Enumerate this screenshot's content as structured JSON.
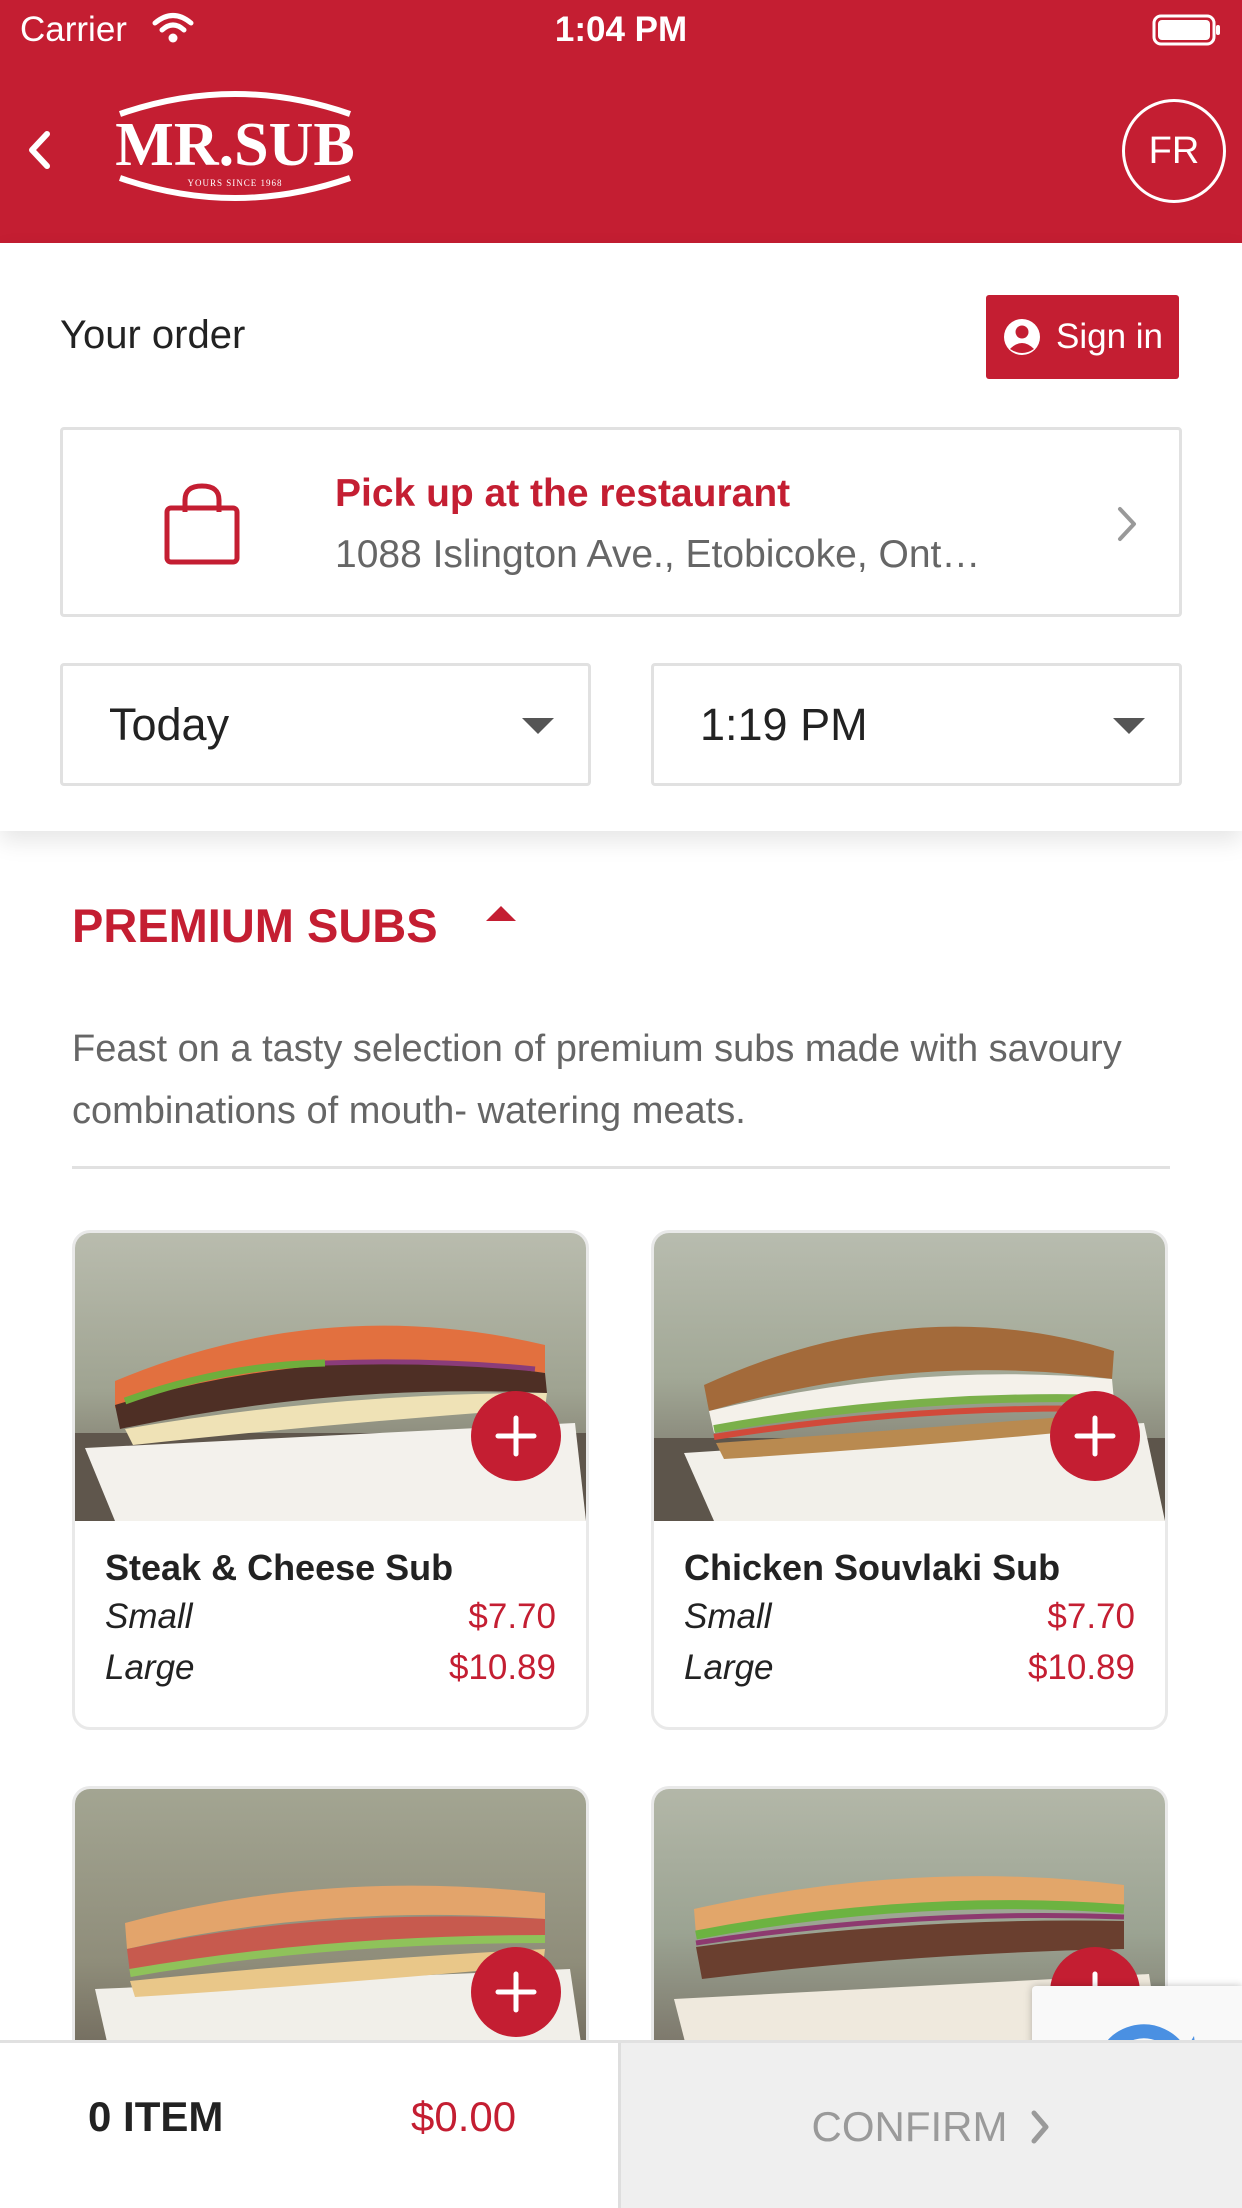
{
  "status_bar": {
    "carrier": "Carrier",
    "time": "1:04 PM"
  },
  "header": {
    "logo_text": "MR.SUB",
    "logo_tagline": "YOURS SINCE 1968",
    "language_button": "FR"
  },
  "order": {
    "title": "Your order",
    "sign_in_label": "Sign in",
    "pickup": {
      "title": "Pick up at the restaurant",
      "address": "1088 Islington Ave., Etobicoke, Ont…"
    },
    "day_value": "Today",
    "time_value": "1:19 PM"
  },
  "category": {
    "title": "PREMIUM SUBS",
    "description": "Feast on a tasty selection of premium subs made with savoury combinations of mouth- watering meats."
  },
  "products": [
    {
      "name": "Steak & Cheese Sub",
      "sizes": [
        {
          "label": "Small",
          "price": "$7.70"
        },
        {
          "label": "Large",
          "price": "$10.89"
        }
      ]
    },
    {
      "name": "Chicken Souvlaki Sub",
      "sizes": [
        {
          "label": "Small",
          "price": "$7.70"
        },
        {
          "label": "Large",
          "price": "$10.89"
        }
      ]
    }
  ],
  "bottom_bar": {
    "item_count": "0 ITEM",
    "total": "$0.00",
    "confirm_label": "CONFIRM"
  },
  "colors": {
    "brand_red": "#c41e32",
    "border_gray": "#e1e1e1",
    "text_gray": "#666666"
  },
  "icons": {
    "back": "chevron-left-icon",
    "sign_in": "user-circle-icon",
    "pickup": "shopping-bag-icon",
    "add": "plus-icon",
    "confirm": "chevron-right-icon"
  }
}
